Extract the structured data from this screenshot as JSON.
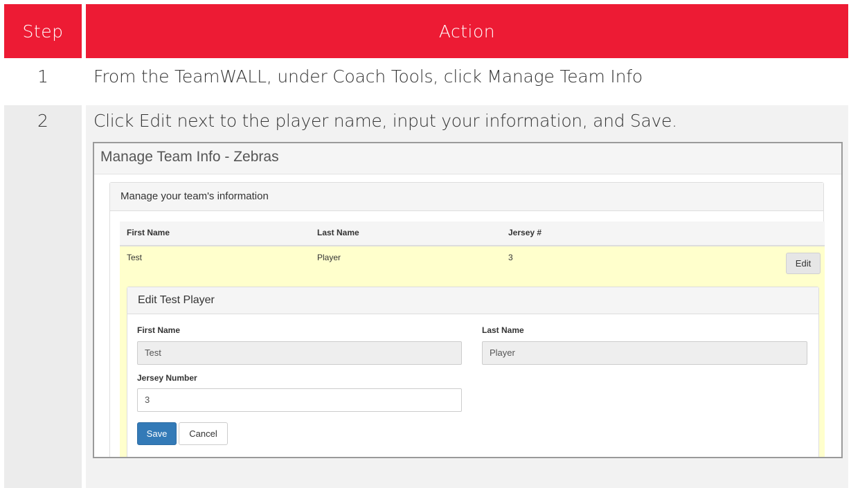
{
  "header": {
    "step_label": "Step",
    "action_label": "Action"
  },
  "steps": [
    {
      "number": "1",
      "text": "From the TeamWALL, under Coach Tools, click Manage Team Info"
    },
    {
      "number": "2",
      "text": "Click Edit next to the player name, input your information, and Save."
    }
  ],
  "colors": {
    "header_bg": "#ed1b34",
    "row_highlight": "#ffffcc",
    "save_button": "#337ab7"
  },
  "screenshot": {
    "page_title": "Manage Team Info - Zebras",
    "panel_heading": "Manage your team's information",
    "table": {
      "columns": [
        "First Name",
        "Last Name",
        "Jersey #"
      ],
      "rows": [
        {
          "first": "Test",
          "last": "Player",
          "jersey": "3",
          "action": "Edit"
        }
      ]
    },
    "edit_form": {
      "heading": "Edit Test Player",
      "first_name_label": "First Name",
      "first_name_value": "Test",
      "last_name_label": "Last Name",
      "last_name_value": "Player",
      "jersey_label": "Jersey Number",
      "jersey_value": "3",
      "save_label": "Save",
      "cancel_label": "Cancel"
    }
  }
}
